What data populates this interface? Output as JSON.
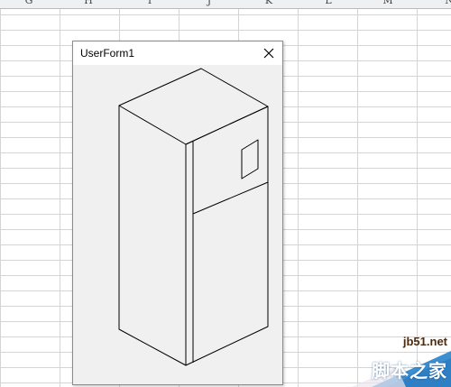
{
  "spreadsheet": {
    "columns": [
      "G",
      "H",
      "I",
      "J",
      "K",
      "L",
      "M",
      "N"
    ]
  },
  "userform": {
    "title": "UserForm1",
    "close_icon": "close-icon",
    "drawing_subject": "refrigerator"
  },
  "watermark": {
    "site": "jb51.net",
    "name": "脚本之家"
  },
  "colors": {
    "form_background": "#f0f0f0",
    "titlebar": "#ffffff",
    "grid_line": "#d4d4d4",
    "drawing_stroke": "#000000"
  }
}
